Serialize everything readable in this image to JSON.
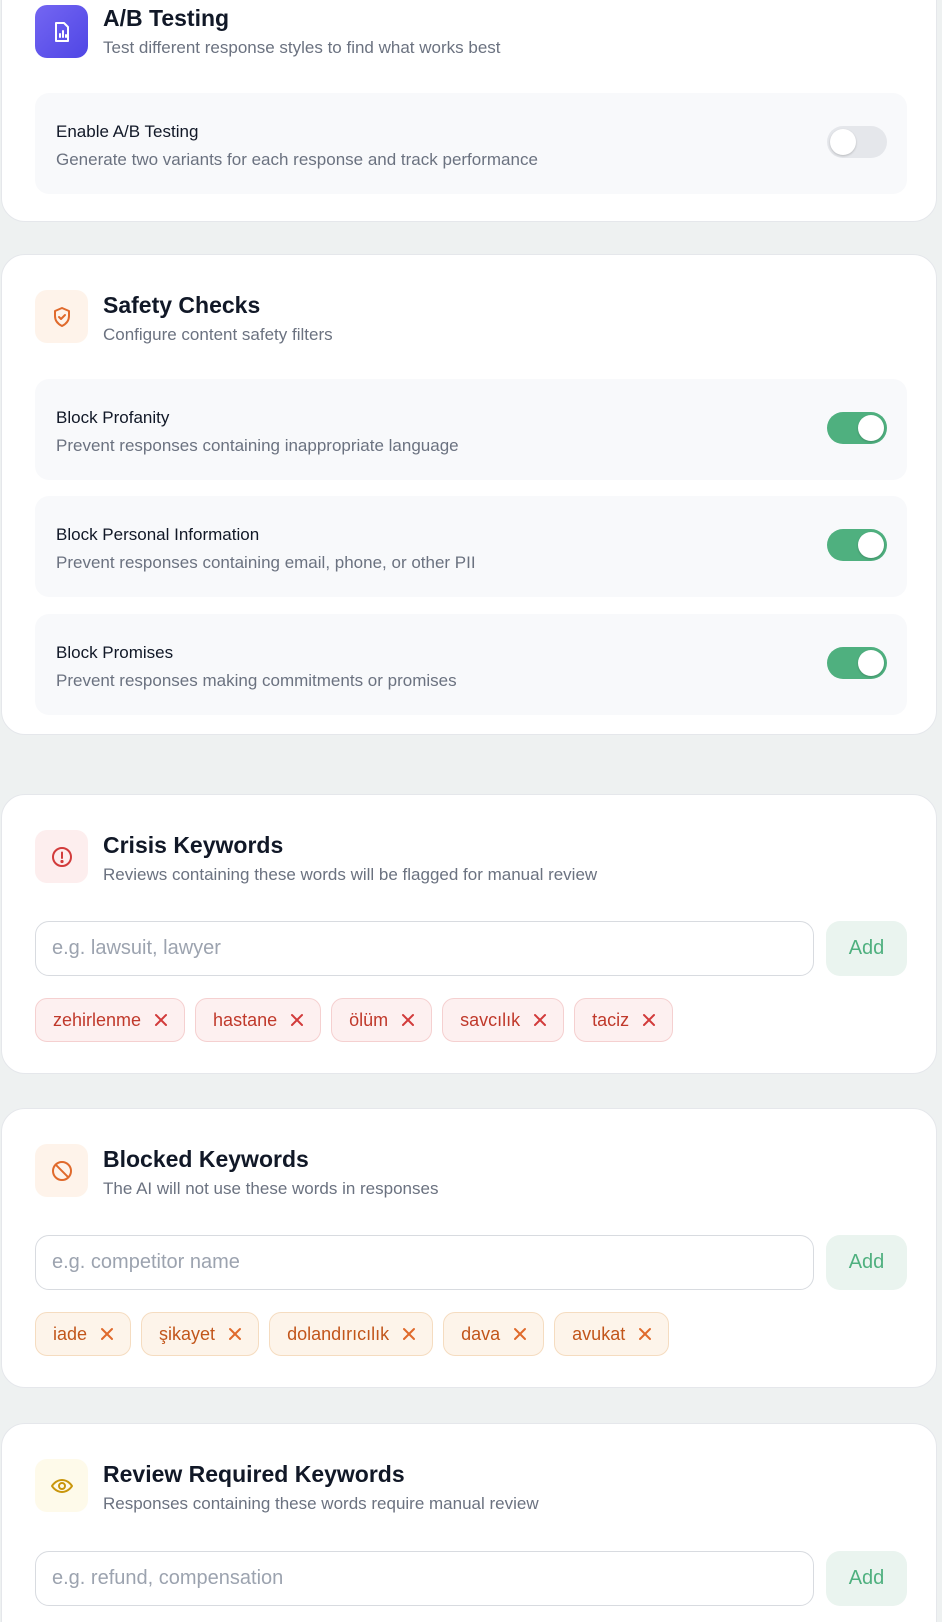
{
  "ab_testing": {
    "title": "A/B Testing",
    "subtitle": "Test different response styles to find what works best",
    "icon": "chart-document-icon",
    "settings": [
      {
        "label": "Enable A/B Testing",
        "description": "Generate two variants for each response and track performance",
        "enabled": false
      }
    ]
  },
  "safety_checks": {
    "title": "Safety Checks",
    "subtitle": "Configure content safety filters",
    "icon": "shield-check-icon",
    "settings": [
      {
        "label": "Block Profanity",
        "description": "Prevent responses containing inappropriate language",
        "enabled": true
      },
      {
        "label": "Block Personal Information",
        "description": "Prevent responses containing email, phone, or other PII",
        "enabled": true
      },
      {
        "label": "Block Promises",
        "description": "Prevent responses making commitments or promises",
        "enabled": true
      }
    ]
  },
  "crisis_keywords": {
    "title": "Crisis Keywords",
    "subtitle": "Reviews containing these words will be flagged for manual review",
    "icon": "alert-circle-icon",
    "input_placeholder": "e.g. lawsuit, lawyer",
    "add_label": "Add",
    "keywords": [
      "zehirlenme",
      "hastane",
      "ölüm",
      "savcılık",
      "taciz"
    ]
  },
  "blocked_keywords": {
    "title": "Blocked Keywords",
    "subtitle": "The AI will not use these words in responses",
    "icon": "ban-icon",
    "input_placeholder": "e.g. competitor name",
    "add_label": "Add",
    "keywords": [
      "iade",
      "şikayet",
      "dolandırıcılık",
      "dava",
      "avukat"
    ]
  },
  "review_keywords": {
    "title": "Review Required Keywords",
    "subtitle": "Responses containing these words require manual review",
    "icon": "eye-icon",
    "input_placeholder": "e.g. refund, compensation",
    "add_label": "Add"
  },
  "colors": {
    "toggle_on": "#4fb07f",
    "toggle_off": "#e5e7eb",
    "crisis": "#c0392b",
    "blocked": "#c2561b",
    "review": "#c9960c",
    "ab_gradient_start": "#6d5df0",
    "ab_gradient_end": "#4f46e5"
  }
}
